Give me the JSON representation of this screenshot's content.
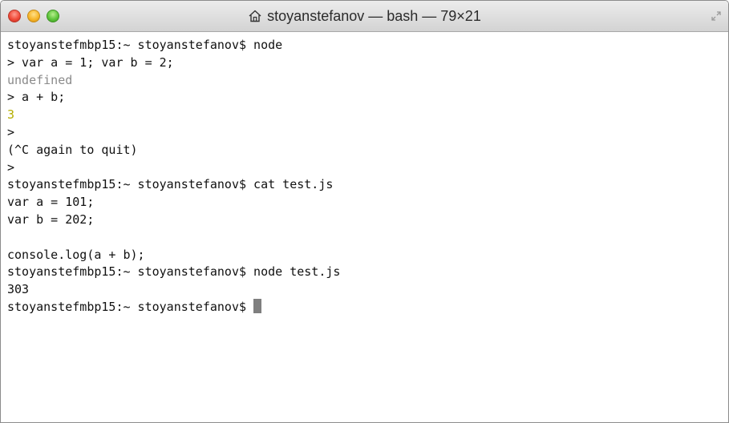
{
  "window": {
    "title": "stoyanstefanov — bash — 79×21",
    "title_icon": "home-icon"
  },
  "colors": {
    "undefined_output": "#8a8a8a",
    "number_output": "#b4ae00",
    "cursor": "#7f7f7f"
  },
  "terminal": {
    "lines": [
      {
        "text": "stoyanstefmbp15:~ stoyanstefanov$ node",
        "style": "default"
      },
      {
        "text": "> var a = 1; var b = 2;",
        "style": "default"
      },
      {
        "text": "undefined",
        "style": "gray"
      },
      {
        "text": "> a + b;",
        "style": "default"
      },
      {
        "text": "3",
        "style": "olive"
      },
      {
        "text": ">",
        "style": "default"
      },
      {
        "text": "(^C again to quit)",
        "style": "default"
      },
      {
        "text": ">",
        "style": "default"
      },
      {
        "text": "stoyanstefmbp15:~ stoyanstefanov$ cat test.js",
        "style": "default"
      },
      {
        "text": "var a = 101;",
        "style": "default"
      },
      {
        "text": "var b = 202;",
        "style": "default"
      },
      {
        "text": "",
        "style": "default"
      },
      {
        "text": "console.log(a + b);",
        "style": "default"
      },
      {
        "text": "stoyanstefmbp15:~ stoyanstefanov$ node test.js",
        "style": "default"
      },
      {
        "text": "303",
        "style": "default"
      }
    ],
    "prompt": "stoyanstefmbp15:~ stoyanstefanov$ "
  }
}
